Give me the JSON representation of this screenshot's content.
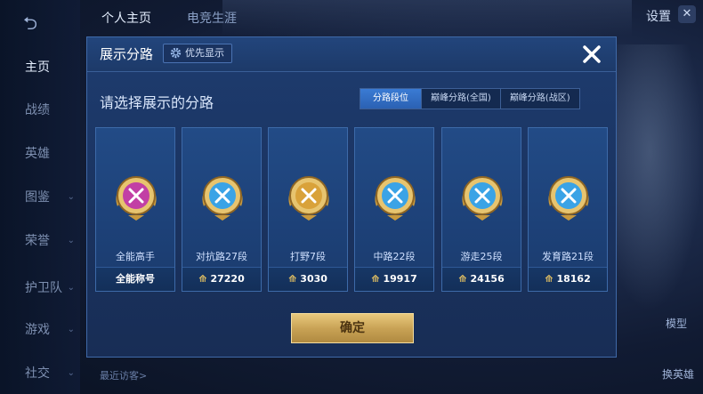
{
  "background": {
    "sidebar": [
      {
        "label": "主页",
        "chevron": false,
        "active": true
      },
      {
        "label": "战绩",
        "chevron": false
      },
      {
        "label": "英雄",
        "chevron": false
      },
      {
        "label": "图鉴",
        "chevron": true
      },
      {
        "label": "荣誉",
        "chevron": true
      },
      {
        "label": "护卫队",
        "chevron": true
      },
      {
        "label": "游戏",
        "chevron": true
      },
      {
        "label": "社交",
        "chevron": true
      }
    ],
    "top_tabs": [
      "个人主页",
      "电竞生涯"
    ],
    "settings_label": "设置",
    "close_label": "✕",
    "right_buttons": [
      "模型",
      "换英雄"
    ],
    "recent_visitors": "最近访客>"
  },
  "modal": {
    "title": "展示分路",
    "priority_button": "优先显示",
    "prompt": "请选择展示的分路",
    "segments": [
      {
        "label": "分路段位",
        "active": true
      },
      {
        "label": "巅峰分路(全国)",
        "active": false
      },
      {
        "label": "巅峰分路(战区)",
        "active": false
      }
    ],
    "cards": [
      {
        "name": "全能高手",
        "value": "全能称号",
        "show_arrow": false,
        "badge": "all-round-badge-icon",
        "color": "#c23fa5"
      },
      {
        "name": "对抗路27段",
        "value": "27220",
        "show_arrow": true,
        "badge": "clash-lane-badge-icon",
        "color": "#3aa3e6"
      },
      {
        "name": "打野7段",
        "value": "3030",
        "show_arrow": true,
        "badge": "jungle-badge-icon",
        "color": "#d9a23a"
      },
      {
        "name": "中路22段",
        "value": "19917",
        "show_arrow": true,
        "badge": "mid-lane-badge-icon",
        "color": "#3aa3e6"
      },
      {
        "name": "游走25段",
        "value": "24156",
        "show_arrow": true,
        "badge": "roam-badge-icon",
        "color": "#3aa3e6"
      },
      {
        "name": "发育路21段",
        "value": "18162",
        "show_arrow": true,
        "badge": "farm-lane-badge-icon",
        "color": "#3aa3e6"
      }
    ],
    "confirm_label": "确定"
  },
  "colors": {
    "accent_gold": "#d8b466",
    "segment_active": "#3a7bd4"
  }
}
